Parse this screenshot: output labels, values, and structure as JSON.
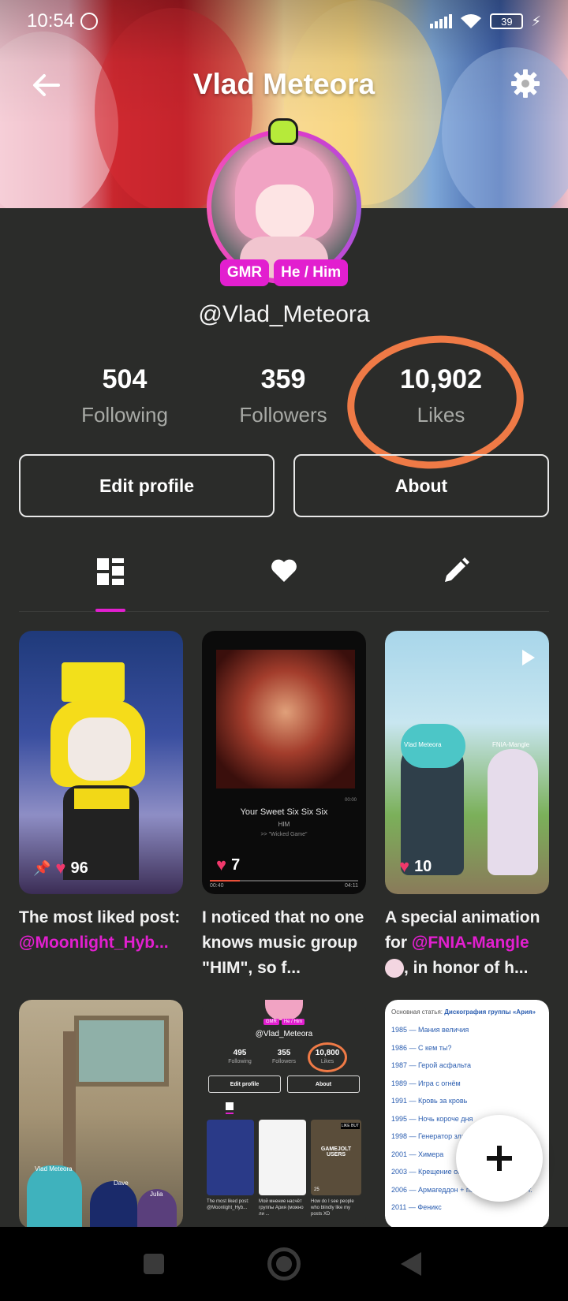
{
  "status_bar": {
    "time": "10:54",
    "battery": "39"
  },
  "header": {
    "title": "Vlad Meteora"
  },
  "profile": {
    "badges": [
      "GMR",
      "He / Him"
    ],
    "username": "@Vlad_Meteora",
    "stats": [
      {
        "value": "504",
        "label": "Following"
      },
      {
        "value": "359",
        "label": "Followers"
      },
      {
        "value": "10,902",
        "label": "Likes"
      }
    ],
    "buttons": {
      "edit": "Edit profile",
      "about": "About"
    }
  },
  "tabs": [
    {
      "icon": "grid-posts-icon",
      "active": true
    },
    {
      "icon": "heart-icon",
      "active": false
    },
    {
      "icon": "pencil-icon",
      "active": false
    }
  ],
  "posts": [
    {
      "likes": "96",
      "pinned": true,
      "caption_text": "The most liked post:",
      "mention": "@Moonlight_Hyb..."
    },
    {
      "likes": "7",
      "caption_text": "I noticed that no one knows music group \"HIM\", so f...",
      "song_title": "Your Sweet Six Six Six",
      "song_artist": "HIM",
      "song_album": ">> \"Wicked Game\"",
      "time_start": "00:40",
      "time_end": "04:11",
      "time_top": "00:00"
    },
    {
      "likes": "10",
      "caption_text_before": "A special animation for",
      "mention": "@FNIA-Mangle",
      "caption_text_after": ", in honor of h...",
      "label_left": "Vlad Meteora",
      "label_right": "FNIA-Mangle"
    },
    {
      "labels": [
        "Vlad Meteora",
        "Dave",
        "Julia"
      ]
    },
    {
      "mini": {
        "badges": [
          "GMR",
          "He / Him"
        ],
        "username": "@Vlad_Meteora",
        "following": "495",
        "followers": "355",
        "likes": "10,800",
        "following_label": "Following",
        "followers_label": "Followers",
        "likes_label": "Likes",
        "edit": "Edit profile",
        "about": "About",
        "cap1": "The most liked post: @Moonlight_Hyb...",
        "cap2": "Мой мнение насчёт группы Ария (можно ли ...",
        "cap3": "How do I see people who blindly like my posts XD",
        "tile_text": "GAMEJOLT USERS",
        "tile_badge": "LIKE BUT",
        "tile_likes": "25"
      }
    },
    {
      "heading_prefix": "Основная статья:",
      "heading_link": "Дискография группы «Ария»",
      "items": [
        "1985 — Мания величия",
        "1986 — С кем ты?",
        "1987 — Герой асфальта",
        "1989 — Игра с огнём",
        "1991 — Кровь за кровь",
        "1995 — Ночь короче дня",
        "1998 — Генератор зла",
        "2001 — Химера",
        "2003 — Крещение огнём 2020 г.",
        "2006 — Армагеддон + переиздание 2020 г.",
        "2011 — Феникс"
      ]
    }
  ],
  "colors": {
    "accent": "#e21fcf",
    "background": "#2b2c2a",
    "highlight_circle": "#ef7a46",
    "heart": "#f0386b"
  }
}
